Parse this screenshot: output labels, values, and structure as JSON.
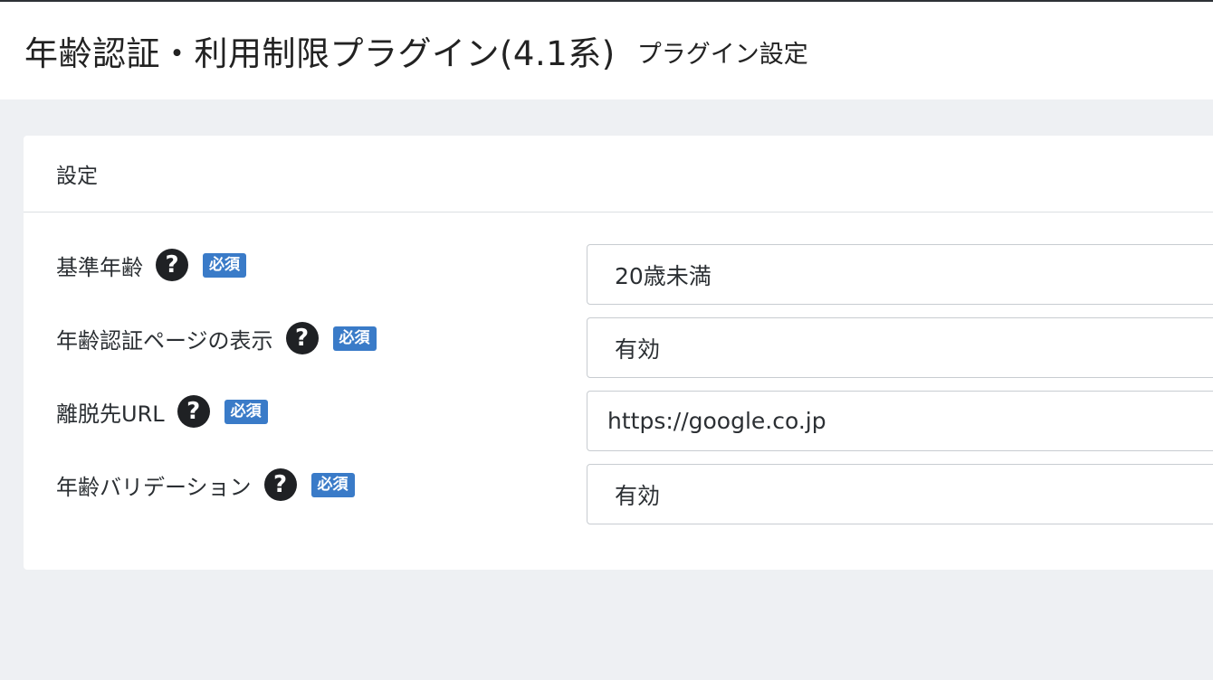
{
  "header": {
    "title": "年齢認証・利用制限プラグイン(4.1系)",
    "subtitle": "プラグイン設定"
  },
  "card": {
    "title": "設定",
    "rows": [
      {
        "label": "基準年齢",
        "badge": "必須",
        "value": "20歳未満",
        "type": "select"
      },
      {
        "label": "年齢認証ページの表示",
        "badge": "必須",
        "value": "有効",
        "type": "select"
      },
      {
        "label": "離脱先URL",
        "badge": "必須",
        "value": "https://google.co.jp",
        "type": "input"
      },
      {
        "label": "年齢バリデーション",
        "badge": "必須",
        "value": "有効",
        "type": "select"
      }
    ]
  },
  "icons": {
    "help": "question-circle-icon"
  },
  "colors": {
    "badge": "#3a7bc8",
    "background": "#eef0f3"
  }
}
